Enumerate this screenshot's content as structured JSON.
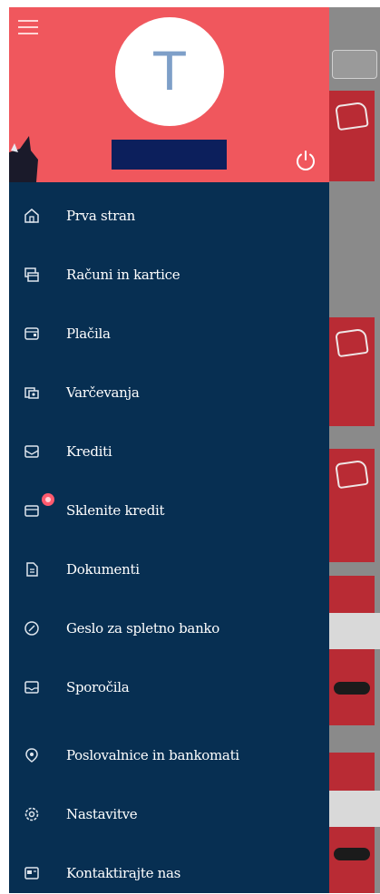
{
  "drawer": {
    "avatar_initial": "T",
    "items": [
      {
        "label": "Prva stran",
        "icon": "home-icon"
      },
      {
        "label": "Računi in kartice",
        "icon": "cards-icon"
      },
      {
        "label": "Plačila",
        "icon": "payments-icon"
      },
      {
        "label": "Varčevanja",
        "icon": "savings-icon"
      },
      {
        "label": "Krediti",
        "icon": "loans-icon"
      },
      {
        "label": "Sklenite kredit",
        "icon": "apply-loan-icon"
      },
      {
        "label": "Dokumenti",
        "icon": "documents-icon"
      },
      {
        "label": "Geslo za spletno banko",
        "icon": "password-icon"
      },
      {
        "label": "Sporočila",
        "icon": "messages-icon"
      },
      {
        "label": "Poslovalnice in bankomati",
        "icon": "branches-icon"
      },
      {
        "label": "Nastavitve",
        "icon": "settings-icon"
      },
      {
        "label": "Kontaktirajte nas",
        "icon": "contact-icon"
      }
    ]
  },
  "colors": {
    "header": "#f0575d",
    "drawer": "#072f52",
    "accent_badge": "#ff5a6e"
  }
}
